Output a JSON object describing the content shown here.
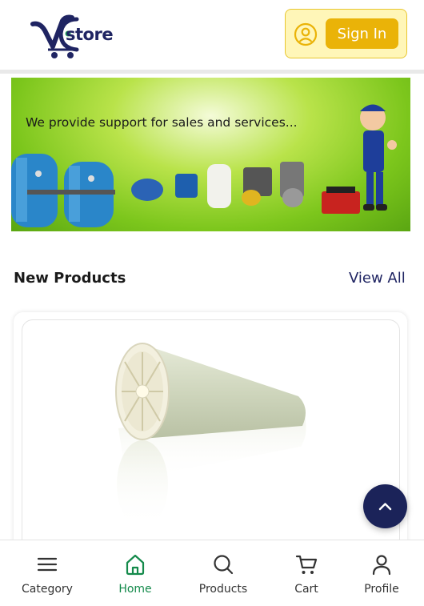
{
  "header": {
    "logo_text": "store",
    "signin_label": "Sign In",
    "brand_color": "#1f2462",
    "accent_color": "#eab308"
  },
  "banner": {
    "text": "We provide support for sales and services..."
  },
  "new_products": {
    "title": "New Products",
    "view_all_label": "View All"
  },
  "bottom_nav": {
    "items": [
      {
        "label": "Category",
        "icon": "menu-icon"
      },
      {
        "label": "Home",
        "icon": "home-icon",
        "active": true
      },
      {
        "label": "Products",
        "icon": "search-icon"
      },
      {
        "label": "Cart",
        "icon": "cart-icon"
      },
      {
        "label": "Profile",
        "icon": "user-icon"
      }
    ],
    "active_color": "#148a4b"
  }
}
